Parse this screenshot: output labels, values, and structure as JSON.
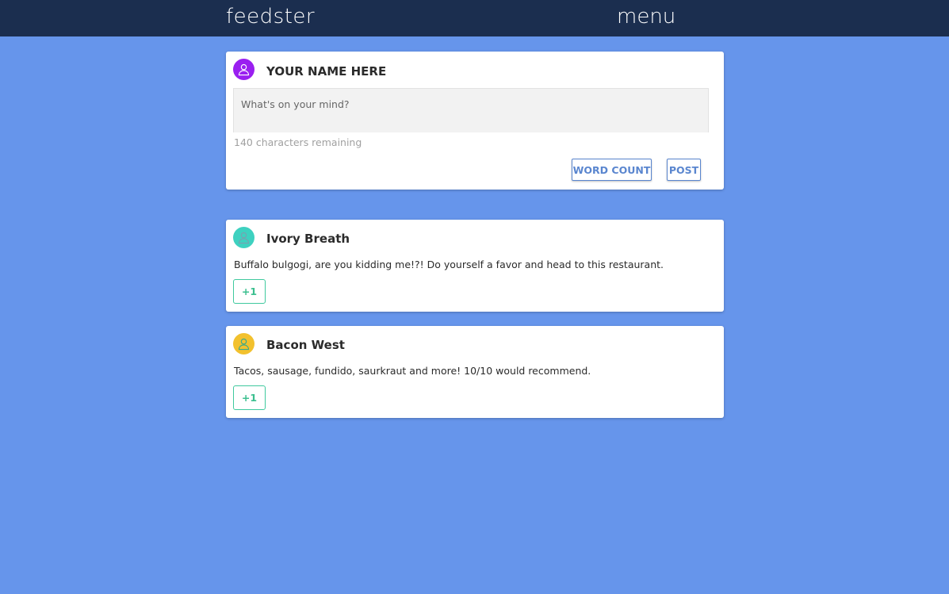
{
  "header": {
    "brand": "feedster",
    "menu_label": "menu"
  },
  "composer": {
    "author": "YOUR NAME HERE",
    "avatar_color": "#9a1ff0",
    "avatar_icon": "user-icon",
    "placeholder": "What's on your mind?",
    "remaining_text": "140 characters remaining",
    "word_count_label": "WORD COUNT",
    "post_label": "POST"
  },
  "posts": [
    {
      "author": "Ivory Breath",
      "avatar_color": "#3ed1c0",
      "avatar_icon": "user-icon",
      "text": "Buffalo bulgogi, are you kidding me!?! Do yourself a favor and head to this restaurant.",
      "vote_label": "+1"
    },
    {
      "author": "Bacon West",
      "avatar_color": "#f2c12e",
      "avatar_icon": "user-icon",
      "text": "Tacos, sausage, fundido, saurkraut and more! 10/10 would recommend.",
      "vote_label": "+1"
    }
  ],
  "colors": {
    "page_background": "#6695eb",
    "topbar": "#1b2e4f",
    "accent_button": "#5a86cf",
    "vote_button": "#3fc99e"
  }
}
